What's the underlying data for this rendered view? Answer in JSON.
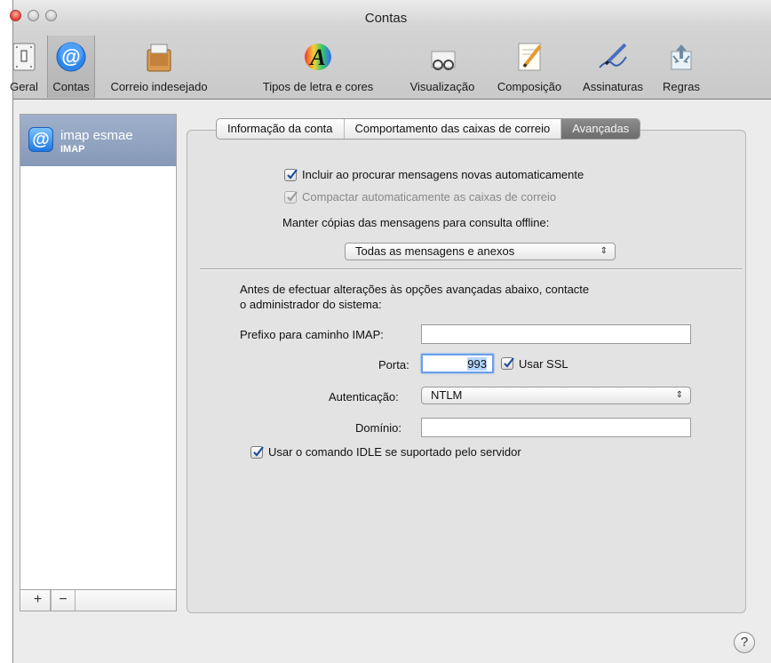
{
  "window": {
    "title": "Contas"
  },
  "toolbar": {
    "items": [
      {
        "label": "Geral"
      },
      {
        "label": "Contas"
      },
      {
        "label": "Correio indesejado"
      },
      {
        "label": "Tipos de letra e cores"
      },
      {
        "label": "Visualização"
      },
      {
        "label": "Composição"
      },
      {
        "label": "Assinaturas"
      },
      {
        "label": "Regras"
      }
    ],
    "selected": "Contas"
  },
  "sidebar": {
    "account": {
      "name": "imap esmae",
      "type": "IMAP",
      "icon": "at-sign-icon"
    },
    "add_label": "+",
    "remove_label": "−"
  },
  "tabs": [
    {
      "label": "Informação da conta"
    },
    {
      "label": "Comportamento das caixas de correio"
    },
    {
      "label": "Avançadas"
    }
  ],
  "active_tab": "Avançadas",
  "advanced": {
    "include_new_mail": {
      "label": "Incluir ao procurar mensagens novas automaticamente",
      "checked": true
    },
    "compact_mailboxes": {
      "label": "Compactar automaticamente as caixas de correio",
      "checked": true,
      "enabled": false
    },
    "keep_copies_label": "Manter cópias das mensagens para consulta offline:",
    "keep_copies_value": "Todas as mensagens e anexos",
    "warning_line1": "Antes de efectuar alterações às opções avançadas abaixo, contacte",
    "warning_line2": "o administrador do sistema:",
    "imap_prefix_label": "Prefixo para caminho IMAP:",
    "imap_prefix_value": "",
    "port_label": "Porta:",
    "port_value": "993",
    "use_ssl": {
      "label": "Usar SSL",
      "checked": true
    },
    "auth_label": "Autenticação:",
    "auth_value": "NTLM",
    "domain_label": "Domínio:",
    "domain_value": "",
    "idle": {
      "label": "Usar o comando IDLE se suportado pelo servidor",
      "checked": true
    }
  },
  "help_label": "?",
  "colors": {
    "selection": "#8699b8",
    "accent": "#1f78e0",
    "checkbox_check": "#1b4f9c"
  }
}
